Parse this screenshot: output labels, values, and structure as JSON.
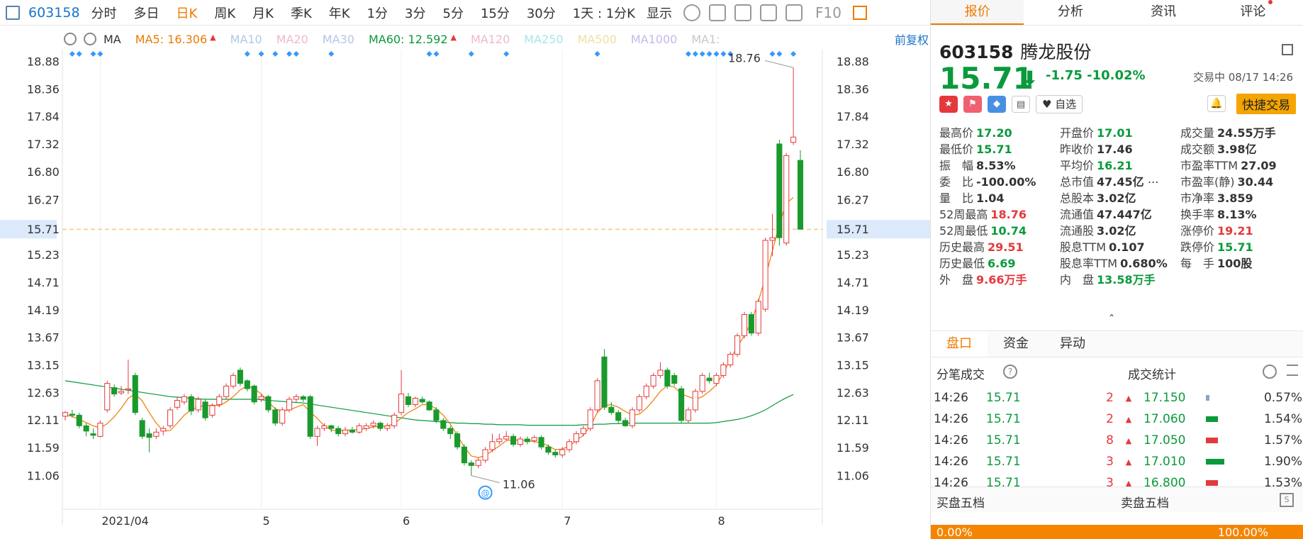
{
  "toolbar": {
    "stock_code": "603158",
    "periods": [
      "分时",
      "多日",
      "日K",
      "周K",
      "月K",
      "季K",
      "年K",
      "1分",
      "3分",
      "5分",
      "15分",
      "30分"
    ],
    "active_period": "日K",
    "interval_select": "1天 : 1分K",
    "display_select": "显示",
    "f10_label": "F10"
  },
  "ma_row": {
    "label": "MA",
    "items": [
      {
        "text": "MA5: 16.306",
        "color": "#ee7a00",
        "arrow": "▲"
      },
      {
        "text": "MA10",
        "color": "#b0c8e8"
      },
      {
        "text": "MA20",
        "color": "#f0b8d0"
      },
      {
        "text": "MA30",
        "color": "#b0c8e8"
      },
      {
        "text": "MA60: 12.592",
        "color": "#0a9a3c",
        "arrow": "▲"
      },
      {
        "text": "MA120",
        "color": "#f0b8d0"
      },
      {
        "text": "MA250",
        "color": "#a8e4f0"
      },
      {
        "text": "MA500",
        "color": "#f0e0a0"
      },
      {
        "text": "MA1000",
        "color": "#c8b8e8"
      },
      {
        "text": "MA1:",
        "color": "#c8c8c8"
      }
    ],
    "adjust_label": "前复权"
  },
  "chart_data": {
    "type": "candlestick",
    "price_axis_ticks": [
      "18.88",
      "18.36",
      "17.84",
      "17.32",
      "16.80",
      "16.27",
      "15.71",
      "15.23",
      "14.71",
      "14.19",
      "13.67",
      "13.15",
      "12.63",
      "12.11",
      "11.59",
      "11.06"
    ],
    "current_price_marker": "15.71",
    "high_label": "18.76",
    "low_label": "11.06",
    "x_labels": [
      "2021/04",
      "5",
      "6",
      "7",
      "8"
    ],
    "ylim": [
      10.8,
      19.1
    ],
    "candles": [
      [
        12.18,
        12.25,
        12.1,
        12.28
      ],
      [
        12.22,
        12.2,
        12.15,
        12.3
      ],
      [
        12.2,
        12.0,
        11.95,
        12.25
      ],
      [
        12.0,
        11.9,
        11.8,
        12.05
      ],
      [
        11.85,
        11.82,
        11.75,
        11.95
      ],
      [
        11.8,
        12.05,
        11.78,
        12.1
      ],
      [
        12.3,
        12.8,
        12.25,
        12.85
      ],
      [
        12.72,
        12.6,
        12.55,
        12.78
      ],
      [
        12.62,
        12.65,
        12.58,
        12.75
      ],
      [
        12.68,
        12.7,
        12.6,
        13.25
      ],
      [
        12.95,
        12.25,
        12.2,
        13.0
      ],
      [
        12.1,
        11.8,
        11.75,
        12.15
      ],
      [
        11.85,
        11.78,
        11.5,
        11.95
      ],
      [
        11.8,
        11.88,
        11.75,
        11.95
      ],
      [
        11.9,
        11.95,
        11.82,
        12.0
      ],
      [
        12.0,
        12.3,
        11.95,
        12.35
      ],
      [
        12.35,
        12.48,
        12.3,
        12.55
      ],
      [
        12.45,
        12.55,
        12.4,
        12.6
      ],
      [
        12.55,
        12.28,
        12.2,
        12.6
      ],
      [
        12.3,
        12.5,
        12.25,
        12.55
      ],
      [
        12.45,
        12.15,
        12.1,
        12.5
      ],
      [
        12.2,
        12.38,
        12.15,
        12.42
      ],
      [
        12.4,
        12.55,
        12.35,
        12.6
      ],
      [
        12.55,
        12.75,
        12.5,
        12.8
      ],
      [
        12.75,
        12.95,
        12.7,
        13.0
      ],
      [
        13.05,
        12.8,
        12.75,
        13.1
      ],
      [
        12.85,
        12.7,
        12.65,
        12.88
      ],
      [
        12.75,
        12.45,
        12.4,
        12.78
      ],
      [
        12.5,
        12.55,
        12.45,
        12.6
      ],
      [
        12.55,
        12.3,
        12.25,
        12.58
      ],
      [
        12.3,
        12.05,
        12.0,
        12.35
      ],
      [
        12.05,
        12.3,
        12.0,
        12.35
      ],
      [
        12.3,
        12.5,
        12.25,
        12.55
      ],
      [
        12.5,
        12.55,
        12.45,
        12.6
      ],
      [
        12.55,
        12.5,
        12.45,
        12.58
      ],
      [
        12.55,
        11.8,
        11.75,
        12.58
      ],
      [
        11.8,
        11.95,
        11.62,
        12.0
      ],
      [
        11.95,
        12.0,
        11.9,
        12.05
      ],
      [
        12.0,
        11.95,
        11.88,
        12.02
      ],
      [
        11.95,
        11.85,
        11.8,
        12.0
      ],
      [
        11.85,
        11.92,
        11.8,
        11.98
      ],
      [
        11.92,
        11.88,
        11.85,
        11.98
      ],
      [
        11.88,
        12.0,
        11.85,
        12.05
      ],
      [
        11.95,
        12.0,
        11.9,
        12.05
      ],
      [
        12.0,
        12.05,
        11.95,
        12.1
      ],
      [
        12.05,
        11.95,
        11.9,
        12.08
      ],
      [
        11.95,
        12.0,
        11.9,
        12.05
      ],
      [
        12.0,
        12.2,
        11.95,
        12.25
      ],
      [
        12.25,
        12.6,
        12.2,
        13.05
      ],
      [
        12.55,
        12.4,
        12.35,
        12.62
      ],
      [
        12.4,
        12.52,
        12.35,
        12.55
      ],
      [
        12.5,
        12.45,
        12.42,
        12.55
      ],
      [
        12.45,
        12.3,
        12.28,
        12.48
      ],
      [
        12.3,
        12.1,
        12.05,
        12.35
      ],
      [
        12.1,
        11.95,
        11.9,
        12.15
      ],
      [
        11.95,
        11.85,
        11.75,
        12.0
      ],
      [
        11.85,
        11.6,
        11.55,
        11.9
      ],
      [
        11.6,
        11.3,
        11.25,
        11.65
      ],
      [
        11.3,
        11.25,
        11.06,
        11.35
      ],
      [
        11.25,
        11.35,
        11.2,
        11.4
      ],
      [
        11.35,
        11.55,
        11.3,
        11.6
      ],
      [
        11.55,
        11.7,
        11.5,
        11.85
      ],
      [
        11.7,
        11.75,
        11.65,
        11.85
      ],
      [
        11.75,
        11.8,
        11.72,
        11.9
      ],
      [
        11.8,
        11.65,
        11.6,
        11.85
      ],
      [
        11.65,
        11.75,
        11.6,
        11.8
      ],
      [
        11.75,
        11.7,
        11.65,
        11.8
      ],
      [
        11.72,
        11.78,
        11.68,
        11.82
      ],
      [
        11.78,
        11.6,
        11.55,
        11.82
      ],
      [
        11.6,
        11.5,
        11.45,
        11.65
      ],
      [
        11.5,
        11.45,
        11.4,
        11.55
      ],
      [
        11.45,
        11.55,
        11.4,
        11.6
      ],
      [
        11.55,
        11.7,
        11.5,
        11.75
      ],
      [
        11.7,
        11.85,
        11.65,
        11.9
      ],
      [
        11.85,
        11.95,
        11.8,
        12.0
      ],
      [
        11.95,
        12.3,
        11.9,
        12.35
      ],
      [
        12.3,
        12.85,
        12.25,
        12.9
      ],
      [
        13.3,
        12.35,
        12.3,
        13.45
      ],
      [
        12.35,
        12.25,
        12.2,
        12.45
      ],
      [
        12.25,
        12.1,
        12.05,
        12.3
      ],
      [
        12.1,
        12.0,
        11.98,
        12.15
      ],
      [
        12.0,
        12.3,
        11.95,
        12.35
      ],
      [
        12.3,
        12.55,
        12.25,
        12.6
      ],
      [
        12.55,
        12.75,
        12.5,
        12.8
      ],
      [
        12.75,
        12.95,
        12.7,
        13.0
      ],
      [
        12.95,
        13.05,
        12.9,
        13.2
      ],
      [
        13.05,
        12.75,
        12.7,
        13.1
      ],
      [
        12.95,
        12.8,
        12.75,
        13.0
      ],
      [
        12.7,
        12.1,
        12.05,
        12.75
      ],
      [
        12.1,
        12.3,
        12.05,
        12.35
      ],
      [
        12.3,
        12.65,
        12.25,
        12.7
      ],
      [
        12.65,
        12.95,
        12.6,
        13.0
      ],
      [
        12.9,
        12.85,
        12.8,
        13.0
      ],
      [
        12.8,
        12.95,
        12.75,
        13.0
      ],
      [
        12.95,
        13.15,
        12.9,
        13.2
      ],
      [
        13.15,
        13.35,
        13.1,
        13.4
      ],
      [
        13.35,
        13.7,
        13.3,
        13.75
      ],
      [
        13.7,
        14.1,
        13.65,
        14.15
      ],
      [
        14.1,
        13.75,
        13.7,
        14.15
      ],
      [
        13.75,
        14.35,
        13.7,
        14.4
      ],
      [
        14.2,
        15.5,
        14.15,
        15.55
      ],
      [
        15.5,
        15.55,
        15.2,
        16.0
      ],
      [
        17.32,
        15.55,
        15.4,
        17.4
      ],
      [
        15.45,
        17.1,
        15.4,
        17.15
      ],
      [
        17.35,
        17.45,
        17.3,
        18.76
      ],
      [
        17.01,
        15.71,
        15.71,
        17.2
      ]
    ],
    "ma5": [
      12.2,
      12.18,
      12.12,
      12.06,
      12.0,
      11.96,
      12.04,
      12.17,
      12.33,
      12.52,
      12.6,
      12.47,
      12.25,
      12.05,
      11.9,
      11.91,
      12.05,
      12.2,
      12.3,
      12.36,
      12.38,
      12.39,
      12.38,
      12.45,
      12.55,
      12.68,
      12.75,
      12.7,
      12.6,
      12.45,
      12.32,
      12.28,
      12.3,
      12.35,
      12.4,
      12.26,
      12.14,
      12.0,
      11.92,
      11.9,
      11.92,
      11.92,
      11.93,
      11.95,
      11.98,
      11.99,
      12.0,
      12.04,
      12.15,
      12.25,
      12.32,
      12.4,
      12.4,
      12.32,
      12.2,
      12.03,
      11.82,
      11.6,
      11.43,
      11.4,
      11.44,
      11.53,
      11.62,
      11.72,
      11.73,
      11.73,
      11.72,
      11.7,
      11.68,
      11.62,
      11.55,
      11.56,
      11.62,
      11.72,
      11.82,
      12.0,
      12.25,
      12.38,
      12.4,
      12.35,
      12.27,
      12.2,
      12.22,
      12.33,
      12.48,
      12.65,
      12.76,
      12.73,
      12.6,
      12.55,
      12.5,
      12.55,
      12.65,
      12.77,
      13.0,
      13.25,
      13.5,
      13.7,
      13.96,
      14.35,
      14.8,
      15.3,
      15.8,
      16.2,
      16.31
    ],
    "ma60": [
      12.85,
      12.83,
      12.81,
      12.79,
      12.77,
      12.75,
      12.73,
      12.71,
      12.69,
      12.67,
      12.65,
      12.63,
      12.61,
      12.59,
      12.57,
      12.55,
      12.54,
      12.53,
      12.52,
      12.51,
      12.5,
      12.5,
      12.5,
      12.5,
      12.5,
      12.5,
      12.5,
      12.5,
      12.49,
      12.48,
      12.47,
      12.46,
      12.45,
      12.44,
      12.43,
      12.41,
      12.39,
      12.37,
      12.35,
      12.33,
      12.31,
      12.29,
      12.27,
      12.25,
      12.23,
      12.21,
      12.19,
      12.17,
      12.15,
      12.13,
      12.11,
      12.1,
      12.09,
      12.08,
      12.07,
      12.06,
      12.05,
      12.05,
      12.04,
      12.04,
      12.03,
      12.03,
      12.02,
      12.02,
      12.02,
      12.02,
      12.01,
      12.01,
      12.01,
      12.01,
      12.01,
      12.01,
      12.01,
      12.01,
      12.02,
      12.02,
      12.03,
      12.03,
      12.04,
      12.04,
      12.05,
      12.05,
      12.05,
      12.05,
      12.05,
      12.05,
      12.05,
      12.05,
      12.05,
      12.05,
      12.05,
      12.05,
      12.05,
      12.06,
      12.08,
      12.1,
      12.12,
      12.15,
      12.19,
      12.24,
      12.3,
      12.38,
      12.46,
      12.53,
      12.59
    ]
  },
  "panel": {
    "tabs": [
      "报价",
      "分析",
      "资讯",
      "评论"
    ],
    "code": "603158",
    "name": "腾龙股份",
    "price": "15.71",
    "arrow": "⬇",
    "change": "-1.75 -10.02%",
    "status": "交易中 08/17 14:26",
    "watch_label": "自选",
    "quick_trade": "快捷交易",
    "stats": [
      [
        {
          "l": "最高价",
          "v": "17.20",
          "c": "green"
        },
        {
          "l": "开盘价",
          "v": "17.01",
          "c": "green"
        },
        {
          "l": "成交量",
          "v": "24.55万手",
          "c": ""
        }
      ],
      [
        {
          "l": "最低价",
          "v": "15.71",
          "c": "green"
        },
        {
          "l": "昨收价",
          "v": "17.46",
          "c": ""
        },
        {
          "l": "成交额",
          "v": "3.98亿",
          "c": ""
        }
      ],
      [
        {
          "l": "振　幅",
          "v": "8.53%",
          "c": ""
        },
        {
          "l": "平均价",
          "v": "16.21",
          "c": "green"
        },
        {
          "l": "市盈率TTM",
          "v": "27.09",
          "c": ""
        }
      ],
      [
        {
          "l": "委　比",
          "v": "-100.00%",
          "c": ""
        },
        {
          "l": "总市值",
          "v": "47.45亿",
          "c": ""
        },
        {
          "l": "市盈率(静)",
          "v": "30.44",
          "c": ""
        }
      ],
      [
        {
          "l": "量　比",
          "v": "1.04",
          "c": ""
        },
        {
          "l": "总股本",
          "v": "3.02亿",
          "c": ""
        },
        {
          "l": "市净率",
          "v": "3.859",
          "c": ""
        }
      ],
      [
        {
          "l": "52周最高",
          "v": "18.76",
          "c": "red"
        },
        {
          "l": "流通值",
          "v": "47.447亿",
          "c": ""
        },
        {
          "l": "换手率",
          "v": "8.13%",
          "c": ""
        }
      ],
      [
        {
          "l": "52周最低",
          "v": "10.74",
          "c": "green"
        },
        {
          "l": "流通股",
          "v": "3.02亿",
          "c": ""
        },
        {
          "l": "涨停价",
          "v": "19.21",
          "c": "red"
        }
      ],
      [
        {
          "l": "历史最高",
          "v": "29.51",
          "c": "red"
        },
        {
          "l": "股息TTM",
          "v": "0.107",
          "c": ""
        },
        {
          "l": "跌停价",
          "v": "15.71",
          "c": "green"
        }
      ],
      [
        {
          "l": "历史最低",
          "v": "6.69",
          "c": "green"
        },
        {
          "l": "股息率TTM",
          "v": "0.680%",
          "c": ""
        },
        {
          "l": "每　手",
          "v": "100股",
          "c": ""
        }
      ],
      [
        {
          "l": "外　盘",
          "v": "9.66万手",
          "c": "red"
        },
        {
          "l": "内　盘",
          "v": "13.58万手",
          "c": "green"
        },
        {
          "l": "",
          "v": "",
          "c": ""
        }
      ]
    ],
    "subtabs": [
      "盘口",
      "资金",
      "异动"
    ],
    "trades_title": "分笔成交",
    "stats_title": "成交统计",
    "trades": [
      {
        "time": "14:26",
        "price": "15.71",
        "vol": "2",
        "sp": "17.150",
        "bar_color": "#8aa4c8",
        "bar_frac": 0.04,
        "pct": "0.57%"
      },
      {
        "time": "14:26",
        "price": "15.71",
        "vol": "2",
        "sp": "17.060",
        "bar_color": "#0a9a3c",
        "bar_frac": 0.14,
        "pct": "1.54%"
      },
      {
        "time": "14:26",
        "price": "15.71",
        "vol": "8",
        "sp": "17.050",
        "bar_color": "#e4393c",
        "bar_frac": 0.14,
        "pct": "1.57%"
      },
      {
        "time": "14:26",
        "price": "15.71",
        "vol": "3",
        "sp": "17.010",
        "bar_color": "#0a9a3c",
        "bar_frac": 0.22,
        "pct": "1.90%"
      },
      {
        "time": "14:26",
        "price": "15.71",
        "vol": "3",
        "sp": "16.800",
        "bar_color": "#e4393c",
        "bar_frac": 0.14,
        "pct": "1.53%"
      }
    ],
    "buy5": "买盘五档",
    "sell5": "卖盘五档",
    "buy_pct": "0.00%",
    "sell_pct": "100.00%"
  }
}
